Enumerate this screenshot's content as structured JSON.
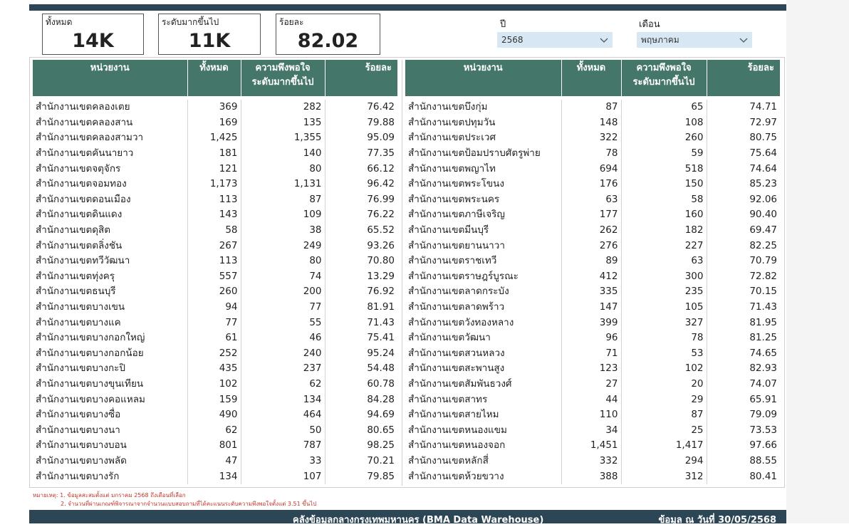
{
  "kpis": [
    {
      "label": "ทั้งหมด",
      "value": "14K"
    },
    {
      "label": "ระดับมากขึ้นไป",
      "value": "11K"
    },
    {
      "label": "ร้อยละ",
      "value": "82.02"
    }
  ],
  "filters": {
    "year": {
      "label": "ปี",
      "value": "2568"
    },
    "month": {
      "label": "เดือน",
      "value": "พฤษภาคม"
    }
  },
  "table": {
    "headers": {
      "unit": "หน่วยงาน",
      "total": "ทั้งหมด",
      "satisfied_line1": "ความพึงพอใจ",
      "satisfied_line2": "ระดับมากขึ้นไป",
      "percent": "ร้อยละ"
    },
    "left_rows": [
      [
        "สำนักงานเขตคลองเตย",
        "369",
        "282",
        "76.42"
      ],
      [
        "สำนักงานเขตคลองสาน",
        "169",
        "135",
        "79.88"
      ],
      [
        "สำนักงานเขตคลองสามวา",
        "1,425",
        "1,355",
        "95.09"
      ],
      [
        "สำนักงานเขตคันนายาว",
        "181",
        "140",
        "77.35"
      ],
      [
        "สำนักงานเขตจตุจักร",
        "121",
        "80",
        "66.12"
      ],
      [
        "สำนักงานเขตจอมทอง",
        "1,173",
        "1,131",
        "96.42"
      ],
      [
        "สำนักงานเขตดอนเมือง",
        "113",
        "87",
        "76.99"
      ],
      [
        "สำนักงานเขตดินแดง",
        "143",
        "109",
        "76.22"
      ],
      [
        "สำนักงานเขตดุสิต",
        "58",
        "38",
        "65.52"
      ],
      [
        "สำนักงานเขตตลิ่งชัน",
        "267",
        "249",
        "93.26"
      ],
      [
        "สำนักงานเขตทวีวัฒนา",
        "113",
        "80",
        "70.80"
      ],
      [
        "สำนักงานเขตทุ่งครุ",
        "557",
        "74",
        "13.29"
      ],
      [
        "สำนักงานเขตธนบุรี",
        "260",
        "200",
        "76.92"
      ],
      [
        "สำนักงานเขตบางเขน",
        "94",
        "77",
        "81.91"
      ],
      [
        "สำนักงานเขตบางแค",
        "77",
        "55",
        "71.43"
      ],
      [
        "สำนักงานเขตบางกอกใหญ่",
        "61",
        "46",
        "75.41"
      ],
      [
        "สำนักงานเขตบางกอกน้อย",
        "252",
        "240",
        "95.24"
      ],
      [
        "สำนักงานเขตบางกะปิ",
        "435",
        "237",
        "54.48"
      ],
      [
        "สำนักงานเขตบางขุนเทียน",
        "102",
        "62",
        "60.78"
      ],
      [
        "สำนักงานเขตบางคอแหลม",
        "159",
        "134",
        "84.28"
      ],
      [
        "สำนักงานเขตบางซื่อ",
        "490",
        "464",
        "94.69"
      ],
      [
        "สำนักงานเขตบางนา",
        "62",
        "50",
        "80.65"
      ],
      [
        "สำนักงานเขตบางบอน",
        "801",
        "787",
        "98.25"
      ],
      [
        "สำนักงานเขตบางพลัด",
        "47",
        "33",
        "70.21"
      ],
      [
        "สำนักงานเขตบางรัก",
        "134",
        "107",
        "79.85"
      ]
    ],
    "right_rows": [
      [
        "สำนักงานเขตบึงกุ่ม",
        "87",
        "65",
        "74.71"
      ],
      [
        "สำนักงานเขตปทุมวัน",
        "148",
        "108",
        "72.97"
      ],
      [
        "สำนักงานเขตประเวศ",
        "322",
        "260",
        "80.75"
      ],
      [
        "สำนักงานเขตป้อมปราบศัตรูพ่าย",
        "78",
        "59",
        "75.64"
      ],
      [
        "สำนักงานเขตพญาไท",
        "694",
        "518",
        "74.64"
      ],
      [
        "สำนักงานเขตพระโขนง",
        "176",
        "150",
        "85.23"
      ],
      [
        "สำนักงานเขตพระนคร",
        "63",
        "58",
        "92.06"
      ],
      [
        "สำนักงานเขตภาษีเจริญ",
        "177",
        "160",
        "90.40"
      ],
      [
        "สำนักงานเขตมีนบุรี",
        "262",
        "182",
        "69.47"
      ],
      [
        "สำนักงานเขตยานนาวา",
        "276",
        "227",
        "82.25"
      ],
      [
        "สำนักงานเขตราชเทวี",
        "89",
        "63",
        "70.79"
      ],
      [
        "สำนักงานเขตราษฎร์บูรณะ",
        "412",
        "300",
        "72.82"
      ],
      [
        "สำนักงานเขตลาดกระบัง",
        "335",
        "235",
        "70.15"
      ],
      [
        "สำนักงานเขตลาดพร้าว",
        "147",
        "105",
        "71.43"
      ],
      [
        "สำนักงานเขตวังทองหลาง",
        "399",
        "327",
        "81.95"
      ],
      [
        "สำนักงานเขตวัฒนา",
        "96",
        "78",
        "81.25"
      ],
      [
        "สำนักงานเขตสวนหลวง",
        "71",
        "53",
        "74.65"
      ],
      [
        "สำนักงานเขตสะพานสูง",
        "123",
        "102",
        "82.93"
      ],
      [
        "สำนักงานเขตสัมพันธวงศ์",
        "27",
        "20",
        "74.07"
      ],
      [
        "สำนักงานเขตสาทร",
        "44",
        "29",
        "65.91"
      ],
      [
        "สำนักงานเขตสายไหม",
        "110",
        "87",
        "79.09"
      ],
      [
        "สำนักงานเขตหนองแขม",
        "34",
        "25",
        "73.53"
      ],
      [
        "สำนักงานเขตหนองจอก",
        "1,451",
        "1,417",
        "97.66"
      ],
      [
        "สำนักงานเขตหลักสี่",
        "332",
        "294",
        "88.55"
      ],
      [
        "สำนักงานเขตห้วยขวาง",
        "388",
        "312",
        "80.41"
      ]
    ]
  },
  "notes": {
    "line1": "หมายเหตุ: 1. ข้อมูลสะสมตั้งแต่ มกราคม 2568 ถึงเดือนที่เลือก",
    "line2": "2. จำนวนที่ผ่านเกณฑ์พิจารณาจากจำนวนแบบสอบถามที่ได้คะแนนระดับความพึงพอใจตั้งแต่ 3.51 ขึ้นไป"
  },
  "footer": {
    "title": "คลังข้อมูลกลางกรุงเทพมหานคร (BMA Data Warehouse)",
    "date": "ข้อมูล ณ วันที่ 30/05/2568"
  },
  "colors": {
    "header_bg": "#447669",
    "bar_bg": "#2c4656",
    "dropdown_bg": "#d7e8f4",
    "note_text": "#c0392b"
  },
  "icons": {
    "dropdown": "chevron-down-icon"
  }
}
